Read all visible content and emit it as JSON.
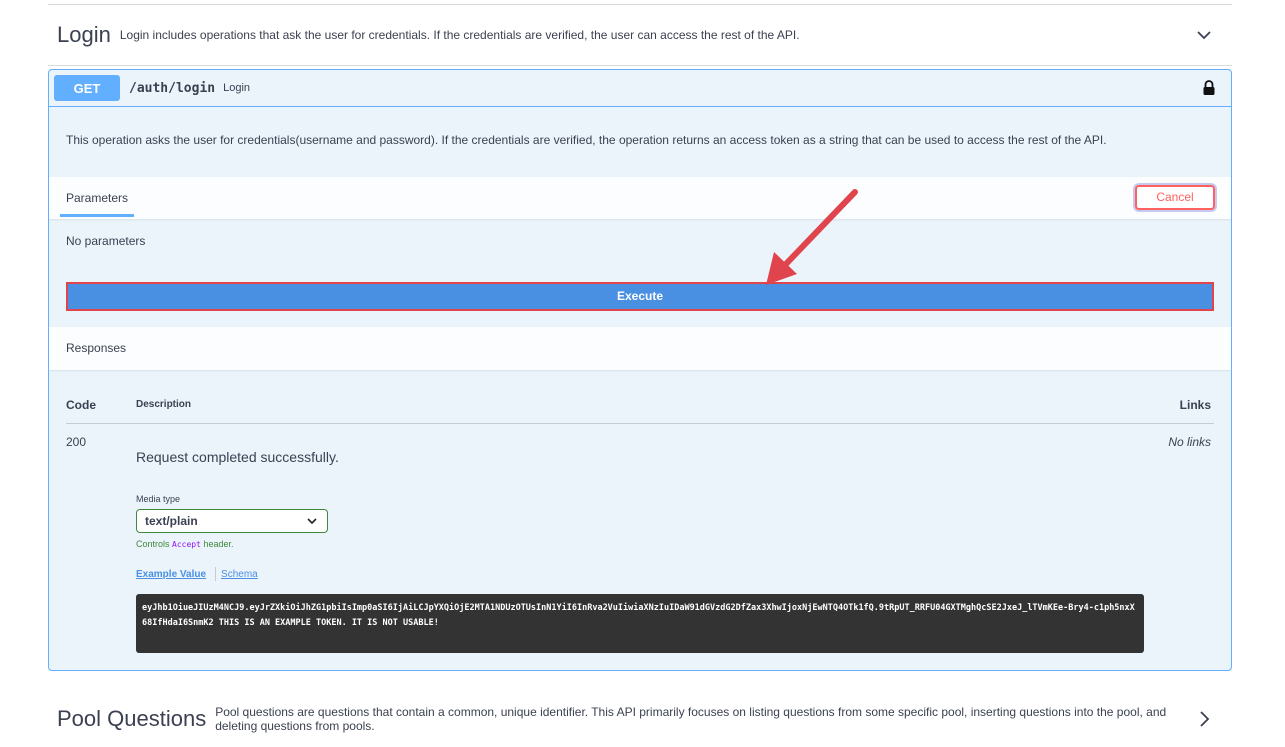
{
  "login_tag": {
    "title": "Login",
    "description": "Login includes operations that ask the user for credentials. If the credentials are verified, the user can access the rest of the API.",
    "chevron_icon": "chevron-down-icon"
  },
  "operation": {
    "method": "GET",
    "path": "/auth/login",
    "summary": "Login",
    "lock_icon": "lock-icon",
    "description": "This operation asks the user for credentials(username and password). If the credentials are verified, the operation returns an access token as a string that can be used to access the rest of the API."
  },
  "parameters": {
    "tab_label": "Parameters",
    "cancel_label": "Cancel",
    "no_params_text": "No parameters",
    "execute_label": "Execute"
  },
  "responses": {
    "heading": "Responses",
    "col_code": "Code",
    "col_description": "Description",
    "col_links": "Links",
    "rows": [
      {
        "code": "200",
        "description": "Request completed successfully.",
        "links": "No links",
        "media_type_label": "Media type",
        "media_type_value": "text/plain",
        "controls_prefix": "Controls",
        "controls_code": "Accept",
        "controls_suffix": "header.",
        "example_tab": "Example Value",
        "schema_tab": "Schema",
        "example_value": "eyJhb1OiueJIUzM4NCJ9.eyJrZXkiOiJhZG1pbiIsImp0aSI6IjAiLCJpYXQiOjE2MTA1NDUzOTUsInN1YiI6InRva2VuIiwiaXNzIuIDaW91dGVzdG2DfZax3XhwIjoxNjEwNTQ4OTk1fQ.9tRpUT_RRFU04GXTMghQcSE2JxeJ_lTVmKEe-Bry4-c1ph5nxX68IfHdaI6SnmK2 THIS IS AN EXAMPLE TOKEN. IT IS NOT USABLE!"
      }
    ]
  },
  "pool_tag": {
    "title": "Pool Questions",
    "description": "Pool questions are questions that contain a common, unique identifier. This API primarily focuses on listing questions from some specific pool, inserting questions into the pool, and deleting questions from pools.",
    "chevron_icon": "chevron-right-icon"
  },
  "colors": {
    "get_blue": "#61affe",
    "execute_blue": "#4990e2",
    "cancel_red": "#ff6060",
    "annotation_red": "#e0444c",
    "media_green": "#41873b"
  }
}
